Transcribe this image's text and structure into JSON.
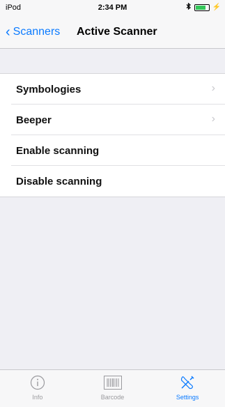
{
  "status_bar": {
    "carrier": "iPod",
    "time": "2:34 PM",
    "battery_level": 0.8
  },
  "nav": {
    "back_label": "Scanners",
    "title": "Active Scanner"
  },
  "menu": [
    {
      "label": "Symbologies",
      "has_chevron": true
    },
    {
      "label": "Beeper",
      "has_chevron": true
    },
    {
      "label": "Enable scanning",
      "has_chevron": false
    },
    {
      "label": "Disable scanning",
      "has_chevron": false
    }
  ],
  "tabs": [
    {
      "label": "Info",
      "icon": "info-icon",
      "active": false
    },
    {
      "label": "Barcode",
      "icon": "barcode-icon",
      "active": false
    },
    {
      "label": "Settings",
      "icon": "tools-icon",
      "active": true
    }
  ],
  "colors": {
    "accent": "#0a7aff",
    "background": "#efeff4"
  }
}
